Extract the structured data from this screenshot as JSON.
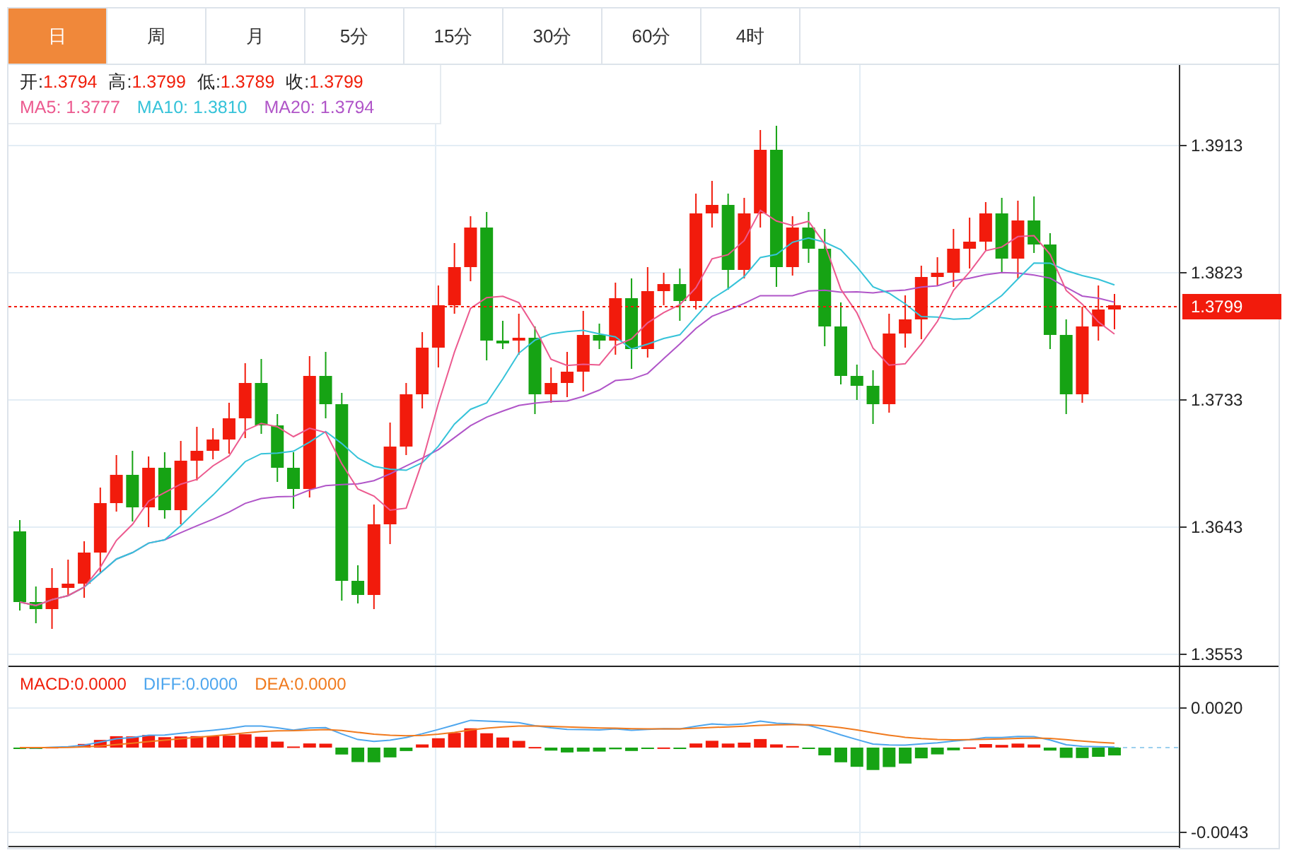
{
  "tabs": [
    {
      "label": "日",
      "selected": true
    },
    {
      "label": "周",
      "selected": false
    },
    {
      "label": "月",
      "selected": false
    },
    {
      "label": "5分",
      "selected": false
    },
    {
      "label": "15分",
      "selected": false
    },
    {
      "label": "30分",
      "selected": false
    },
    {
      "label": "60分",
      "selected": false
    },
    {
      "label": "4时",
      "selected": false
    }
  ],
  "ohlc_legend": [
    {
      "label": "开:",
      "value": "1.3794"
    },
    {
      "label": "高:",
      "value": "1.3799"
    },
    {
      "label": "低:",
      "value": "1.3789"
    },
    {
      "label": "收:",
      "value": "1.3799"
    }
  ],
  "ma_legend": [
    {
      "label": "MA5:",
      "value": "1.3777",
      "color": "#ec5a8f"
    },
    {
      "label": "MA10:",
      "value": "1.3810",
      "color": "#36c3d9"
    },
    {
      "label": "MA20:",
      "value": "1.3794",
      "color": "#b055c8"
    }
  ],
  "price_axis": {
    "ticks": [
      "1.3913",
      "1.3823",
      "1.3733",
      "1.3643",
      "1.3553"
    ],
    "current_price": "1.3799"
  },
  "macd_legend": [
    {
      "label": "MACD:",
      "value": "0.0000",
      "color": "#f01e0a"
    },
    {
      "label": "DIFF:",
      "value": "0.0000",
      "color": "#4ea6ee"
    },
    {
      "label": "DEA:",
      "value": "0.0000",
      "color": "#f07a1e"
    }
  ],
  "macd_axis": {
    "ticks": [
      "0.0020",
      "-0.0043"
    ]
  }
}
